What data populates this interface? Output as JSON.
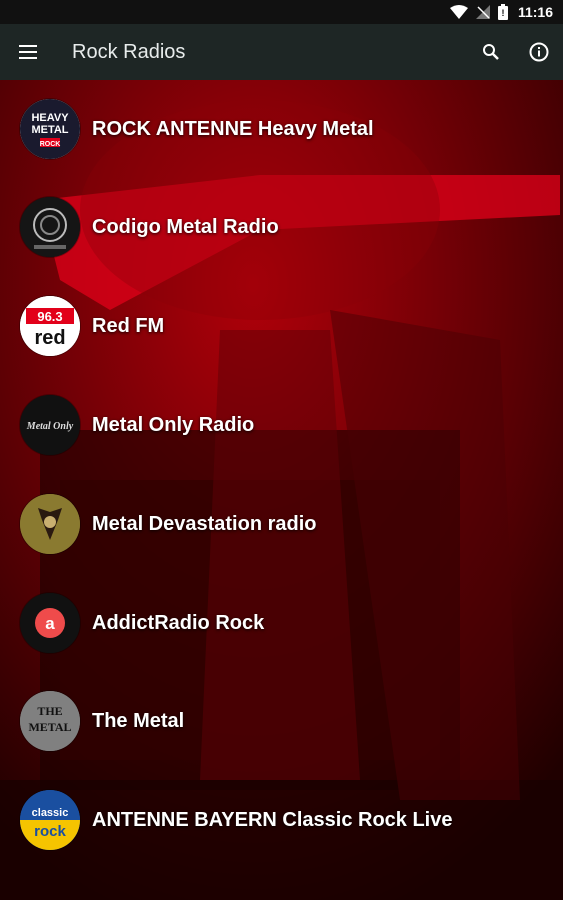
{
  "status_bar": {
    "time": "11:16"
  },
  "app_bar": {
    "title": "Rock Radios"
  },
  "stations": [
    {
      "name": "ROCK ANTENNE Heavy Metal",
      "logo": {
        "line1": "HEAVY",
        "line2": "METAL",
        "line3": "ROCK"
      }
    },
    {
      "name": "Codigo Metal Radio"
    },
    {
      "name": "Red FM",
      "logo": {
        "line1": "96.3",
        "line2": "red"
      }
    },
    {
      "name": "Metal Only Radio",
      "logo": {
        "line1": "Metal Only"
      }
    },
    {
      "name": "Metal Devastation radio"
    },
    {
      "name": "AddictRadio Rock",
      "logo": {
        "line1": "a"
      }
    },
    {
      "name": "The Metal",
      "logo": {
        "line1": "THE",
        "line2": "METAL"
      }
    },
    {
      "name": "ANTENNE BAYERN Classic Rock Live",
      "logo": {
        "line1": "classic",
        "line2": "rock"
      }
    }
  ],
  "colors": {
    "app_bar": "#1e2625",
    "background_tint": "#c0000a",
    "text": "#ffffff"
  }
}
